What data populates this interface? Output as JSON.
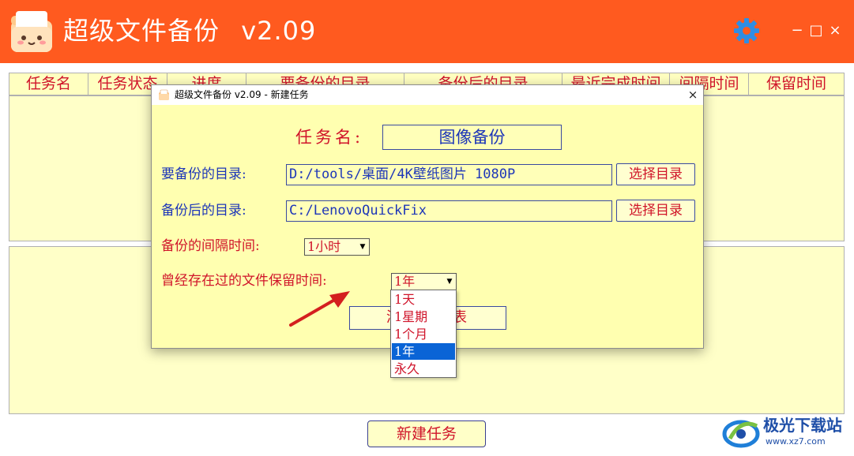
{
  "app": {
    "title": "超级文件备份",
    "version": "v2.09",
    "window_controls": {
      "minimize": "−",
      "maximize": "□",
      "close": "×"
    },
    "settings_icon": "gear-icon",
    "accent_color": "#ff5a1f"
  },
  "task_table": {
    "columns": [
      "任务名",
      "任务状态",
      "进度",
      "要备份的目录",
      "备份后的目录",
      "最近完成时间",
      "间隔时间",
      "保留时间"
    ],
    "rows": []
  },
  "new_task_button": "新建任务",
  "dialog": {
    "title": "超级文件备份 v2.09 - 新建任务",
    "close_label": "×",
    "task_name_label": "任务名:",
    "task_name_value": "图像备份",
    "source_dir_label": "要备份的目录:",
    "source_dir_value": "D:/tools/桌面/4K壁纸图片 1080P",
    "target_dir_label": "备份后的目录:",
    "target_dir_value": "C:/LenovoQuickFix",
    "choose_dir_button": "选择目录",
    "interval_label": "备份的间隔时间:",
    "interval_value": "1小时",
    "retention_label": "曾经存在过的文件保留时间:",
    "retention_value": "1年",
    "retention_options": [
      "1天",
      "1星期",
      "1个月",
      "1年",
      "永久"
    ],
    "retention_selected_index": 3,
    "add_button": "添加到列表"
  },
  "watermark": {
    "title": "极光下载站",
    "url": "www.xz7.com"
  }
}
